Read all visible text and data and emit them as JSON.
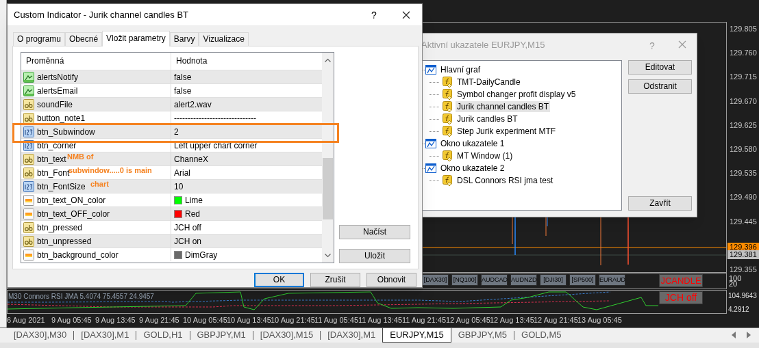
{
  "indicator_dialog": {
    "title": "Custom Indicator - Jurik channel candles BT",
    "help": "?",
    "tabs": [
      {
        "label": "O programu",
        "selected": false
      },
      {
        "label": "Obecné",
        "selected": false
      },
      {
        "label": "Vložit parametry",
        "selected": true
      },
      {
        "label": "Barvy",
        "selected": false
      },
      {
        "label": "Vizualizace",
        "selected": false
      }
    ],
    "columns": [
      "Proměnná",
      "Hodnota"
    ],
    "rows": [
      {
        "kind": "bool",
        "name": "alertsNotify",
        "value": "false"
      },
      {
        "kind": "bool",
        "name": "alertsEmail",
        "value": "false"
      },
      {
        "kind": "string",
        "name": "soundFile",
        "value": "alert2.wav"
      },
      {
        "kind": "string",
        "name": "button_note1",
        "value": "------------------------------"
      },
      {
        "kind": "number",
        "name": "btn_Subwindow",
        "value": "2"
      },
      {
        "kind": "number",
        "name": "btn_corner",
        "value": "Left upper chart corner"
      },
      {
        "kind": "string",
        "name": "btn_text",
        "value": "ChanneX"
      },
      {
        "kind": "string",
        "name": "btn_Font",
        "value": "Arial"
      },
      {
        "kind": "number",
        "name": "btn_FontSize",
        "value": "10"
      },
      {
        "kind": "color",
        "name": "btn_text_ON_color",
        "value": "Lime",
        "color": "#00ff00"
      },
      {
        "kind": "color",
        "name": "btn_text_OFF_color",
        "value": "Red",
        "color": "#ff0000"
      },
      {
        "kind": "string",
        "name": "btn_pressed",
        "value": "JCH off"
      },
      {
        "kind": "string",
        "name": "btn_unpressed",
        "value": "JCH on"
      },
      {
        "kind": "color",
        "name": "btn_background_color",
        "value": "DimGray",
        "color": "#696969"
      }
    ],
    "side_buttons": [
      "Načíst",
      "Uložit"
    ],
    "buttons": [
      {
        "label": "OK",
        "default": true
      },
      {
        "label": "Zrušit",
        "default": false
      },
      {
        "label": "Obnovit",
        "default": false
      }
    ],
    "annotation": [
      "NMB of",
      "subwindow.....0 is main",
      "chart"
    ]
  },
  "indicators_dialog": {
    "title": "Aktivní ukazatele EURJPY,M15",
    "help": "?",
    "tree": [
      {
        "label": "Hlavní graf",
        "selected": false,
        "children": [
          {
            "label": "TMT-DailyCandle",
            "selected": false
          },
          {
            "label": "Symbol changer profit display v5",
            "selected": false
          },
          {
            "label": "Jurik channel candles BT",
            "selected": true
          },
          {
            "label": "Jurik candles BT",
            "selected": false
          },
          {
            "label": "Step Jurik experiment MTF",
            "selected": false
          }
        ]
      },
      {
        "label": "Okno ukazatele 1",
        "selected": false,
        "children": [
          {
            "label": "MT Window (1)",
            "selected": false
          }
        ]
      },
      {
        "label": "Okno ukazatele 2",
        "selected": false,
        "children": [
          {
            "label": "DSL Connors RSI jma test",
            "selected": false
          }
        ]
      }
    ],
    "buttons": [
      "Editovat",
      "Odstranit"
    ],
    "close_button": "Zavřít"
  },
  "chart": {
    "price_axis": [
      {
        "kind": "tick",
        "label": "129.805"
      },
      {
        "kind": "tick",
        "label": "129.760"
      },
      {
        "kind": "tick",
        "label": "129.715"
      },
      {
        "kind": "tick",
        "label": "129.670"
      },
      {
        "kind": "tick",
        "label": "129.625"
      },
      {
        "kind": "tick",
        "label": "129.580"
      },
      {
        "kind": "tick",
        "label": "129.535"
      },
      {
        "kind": "tick",
        "label": "129.490"
      },
      {
        "kind": "tick",
        "label": "129.445"
      },
      {
        "kind": "bid",
        "label": "129.396"
      },
      {
        "kind": "last",
        "label": "129.381"
      },
      {
        "kind": "tick",
        "label": "129.355"
      }
    ],
    "symbol_buttons": [
      "[DAX30]",
      "[NQ100]",
      "AUDCAD",
      "AUDNZD",
      "[DJI30]",
      "[SP500]",
      "EURAUD"
    ],
    "jcandle_button": "JCANDLE",
    "subwindow1_scale": [
      "100",
      "20"
    ],
    "indicator_label": "M30 Connors RSI JMA 5.4074 75.4557 24.9457",
    "jch_button": "JCH off",
    "subwindow2_scale": [
      "104.9643",
      "4.2912"
    ],
    "time_axis": [
      "6 Aug 2021",
      "9 Aug 05:45",
      "9 Aug 13:45",
      "9 Aug 21:45",
      "10 Aug 05:45",
      "10 Aug 13:45",
      "10 Aug 21:45",
      "11 Aug 05:45",
      "11 Aug 13:45",
      "11 Aug 21:45",
      "12 Aug 05:45",
      "12 Aug 13:45",
      "12 Aug 21:45",
      "13 Aug 05:45"
    ]
  },
  "chart_tabs": [
    {
      "label": "[DAX30],M30",
      "selected": false
    },
    {
      "label": "[DAX30],M1",
      "selected": false
    },
    {
      "label": "GOLD,H1",
      "selected": false
    },
    {
      "label": "GBPJPY,M1",
      "selected": false
    },
    {
      "label": "[DAX30],M15",
      "selected": false
    },
    {
      "label": "[DAX30],M1",
      "selected": false
    },
    {
      "label": "EURJPY,M15",
      "selected": true
    },
    {
      "label": "GBPJPY,M5",
      "selected": false
    },
    {
      "label": "GOLD,M5",
      "selected": false
    }
  ]
}
